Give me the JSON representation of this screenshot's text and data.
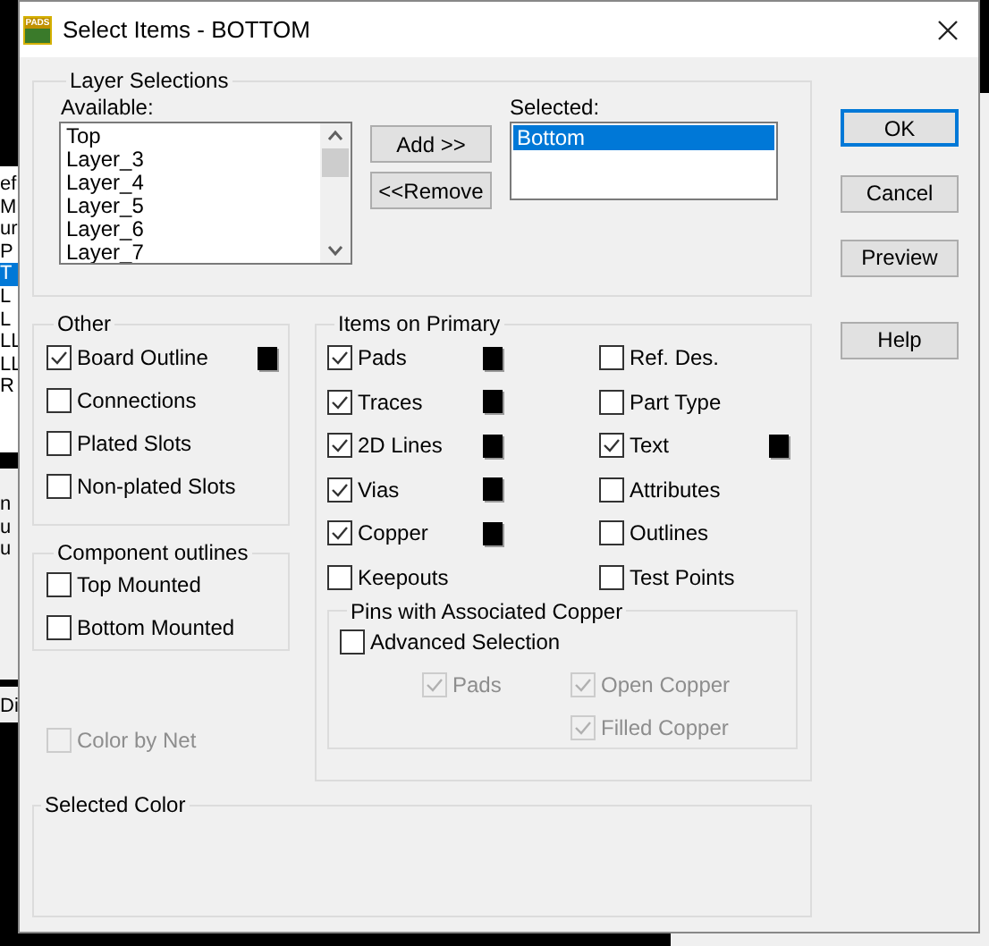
{
  "background": {
    "left_fragments": [
      {
        "text": "ef",
        "selected": false
      },
      {
        "text": "M",
        "selected": false
      },
      {
        "text": "ur",
        "selected": false
      },
      {
        "text": "P",
        "selected": false
      },
      {
        "text": "T",
        "selected": true
      },
      {
        "text": "L",
        "selected": false
      },
      {
        "text": "L",
        "selected": false
      },
      {
        "text": "LL",
        "selected": false
      },
      {
        "text": "LL",
        "selected": false
      },
      {
        "text": "R",
        "selected": false
      }
    ],
    "left_fragments_2": [
      "n",
      "u",
      "u"
    ],
    "left_fragment_3": "Di"
  },
  "window": {
    "title": "Select Items - BOTTOM",
    "icon_text": "PADS"
  },
  "layer_selections": {
    "title": "Layer Selections",
    "available_label": "Available:",
    "available": [
      {
        "label": "Top",
        "selected": false
      },
      {
        "label": "Layer_3",
        "selected": false
      },
      {
        "label": "Layer_4",
        "selected": false
      },
      {
        "label": "Layer_5",
        "selected": false
      },
      {
        "label": "Layer_6",
        "selected": false
      },
      {
        "label": "Layer_7",
        "selected": false
      }
    ],
    "add_button": "Add >>",
    "remove_button": "<<Remove",
    "selected_label": "Selected:",
    "selected_layers": [
      {
        "label": "Bottom",
        "selected": true
      }
    ]
  },
  "buttons": [
    {
      "label": "OK",
      "default": true
    },
    {
      "label": "Cancel",
      "default": false
    },
    {
      "label": "Preview",
      "default": false
    },
    {
      "label": "Help",
      "default": false
    }
  ],
  "other": {
    "title": "Other",
    "items": [
      {
        "label": "Board Outline",
        "checked": true,
        "color": "#000000"
      },
      {
        "label": "Connections",
        "checked": false
      },
      {
        "label": "Plated Slots",
        "checked": false
      },
      {
        "label": "Non-plated Slots",
        "checked": false
      }
    ]
  },
  "component_outlines": {
    "title": "Component outlines",
    "items": [
      {
        "label": "Top Mounted",
        "checked": false
      },
      {
        "label": "Bottom Mounted",
        "checked": false
      }
    ]
  },
  "color_by_net": {
    "label": "Color by Net",
    "checked": false,
    "disabled": true
  },
  "items_on_primary": {
    "title": "Items on Primary",
    "columns": [
      [
        {
          "label": "Pads",
          "checked": true,
          "color": "#000000"
        },
        {
          "label": "Traces",
          "checked": true,
          "color": "#000000"
        },
        {
          "label": "2D Lines",
          "checked": true,
          "color": "#000000"
        },
        {
          "label": "Vias",
          "checked": true,
          "color": "#000000"
        },
        {
          "label": "Copper",
          "checked": true,
          "color": "#000000"
        },
        {
          "label": "Keepouts",
          "checked": false
        }
      ],
      [
        {
          "label": "Ref. Des.",
          "checked": false
        },
        {
          "label": "Part Type",
          "checked": false
        },
        {
          "label": "Text",
          "checked": true,
          "color": "#000000"
        },
        {
          "label": "Attributes",
          "checked": false
        },
        {
          "label": "Outlines",
          "checked": false
        },
        {
          "label": "Test Points",
          "checked": false
        }
      ]
    ]
  },
  "pins_with_associated_copper": {
    "title": "Pins with Associated Copper",
    "advanced_selection": {
      "label": "Advanced Selection",
      "checked": false
    },
    "items": [
      {
        "label": "Pads",
        "checked": true,
        "disabled": true
      },
      {
        "label": "Open Copper",
        "checked": true,
        "disabled": true
      },
      {
        "label": "Filled Copper",
        "checked": true,
        "disabled": true
      }
    ]
  },
  "selected_color": {
    "title": "Selected Color"
  }
}
